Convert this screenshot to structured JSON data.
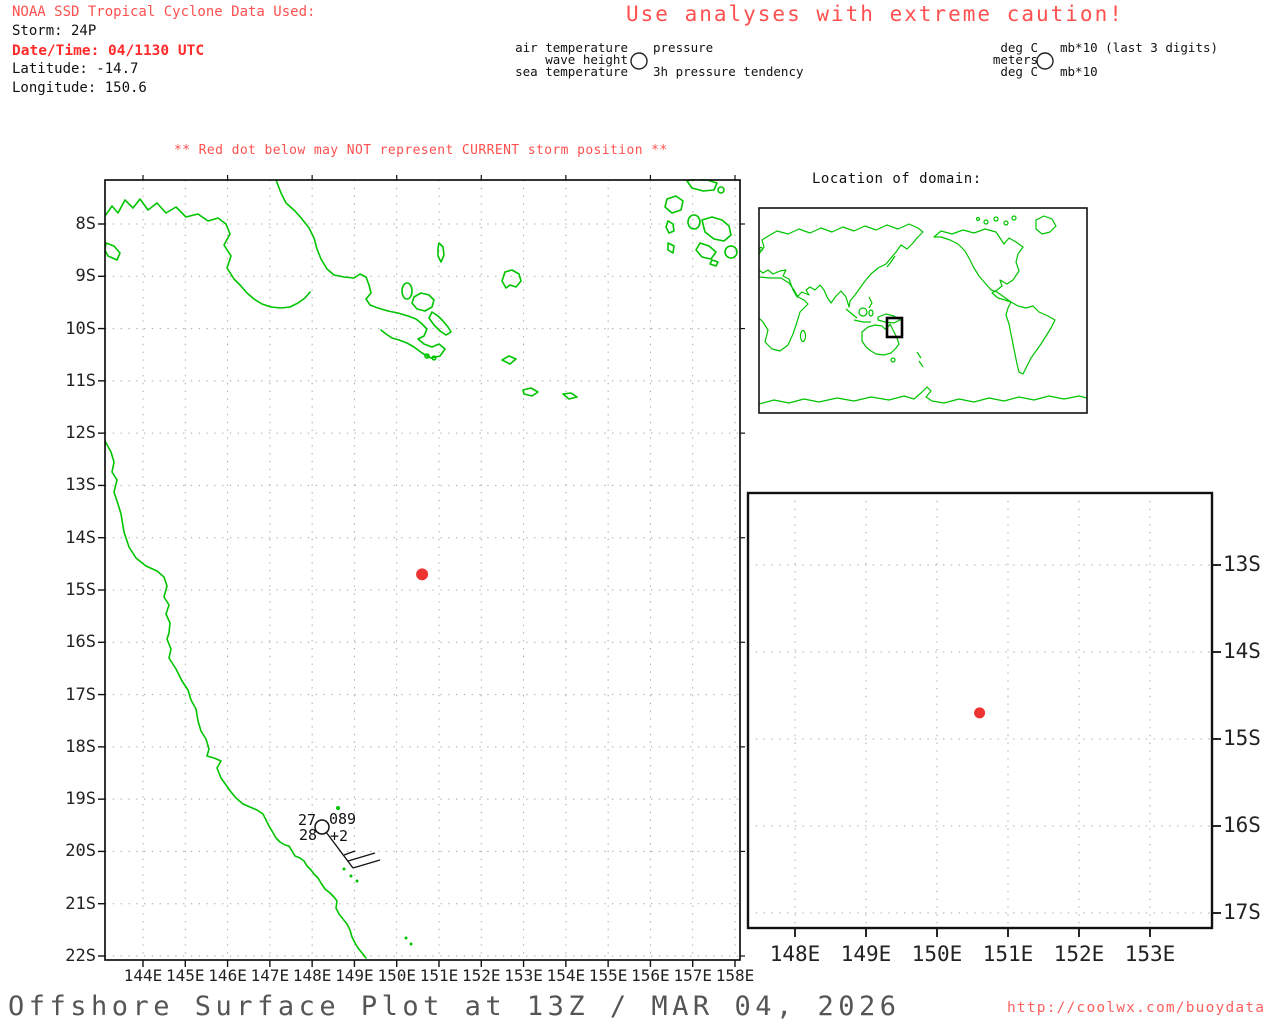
{
  "header": {
    "noaa_title": "NOAA SSD Tropical Cyclone Data Used:",
    "storm_line": "Storm: 24P",
    "datetime_line": "Date/Time: 04/1130 UTC",
    "latitude_line": "Latitude: -14.7",
    "longitude_line": "Longitude: 150.6",
    "caution": "Use analyses with extreme caution!",
    "warning": "** Red dot below may NOT represent CURRENT storm position **"
  },
  "station_legend": {
    "left_labels": [
      "air temperature",
      "wave height",
      "sea temperature"
    ],
    "right_top": "pressure",
    "right_bottom": "3h pressure tendency"
  },
  "units_legend": {
    "left_labels": [
      "deg C",
      "meters",
      "deg C"
    ],
    "right_top": "mb*10 (last 3 digits)",
    "right_bottom": "mb*10"
  },
  "main_map": {
    "lat_tick_labels": [
      "8S",
      "9S",
      "10S",
      "11S",
      "12S",
      "13S",
      "14S",
      "15S",
      "16S",
      "17S",
      "18S",
      "19S",
      "20S",
      "21S",
      "22S"
    ],
    "lon_tick_labels": [
      "144E",
      "145E",
      "146E",
      "147E",
      "148E",
      "149E",
      "150E",
      "151E",
      "152E",
      "153E",
      "154E",
      "155E",
      "156E",
      "157E",
      "158E"
    ],
    "storm_dot": {
      "lat": -14.7,
      "lon": 150.6
    },
    "station_report": {
      "air_temperature": "27",
      "pressure": "089",
      "sea_temperature": "28",
      "pressure_tendency": "+2"
    }
  },
  "inset_map": {
    "title": "Location of domain:"
  },
  "zoom_map": {
    "lon_tick_labels": [
      "148E",
      "149E",
      "150E",
      "151E",
      "152E",
      "153E"
    ],
    "lat_tick_labels": [
      "13S",
      "14S",
      "15S",
      "16S",
      "17S"
    ],
    "storm_dot": {
      "lat": -14.7,
      "lon": 150.6
    }
  },
  "footer": {
    "title": "Offshore Surface Plot at 13Z / MAR 04, 2026",
    "url": "http://coolwx.com/buoydata"
  },
  "colors": {
    "coastline": "#00c400",
    "alert_red": "#ff5050",
    "storm_dot": "#ee3333",
    "grid": "#a8a8a8",
    "frame": "#111111"
  }
}
